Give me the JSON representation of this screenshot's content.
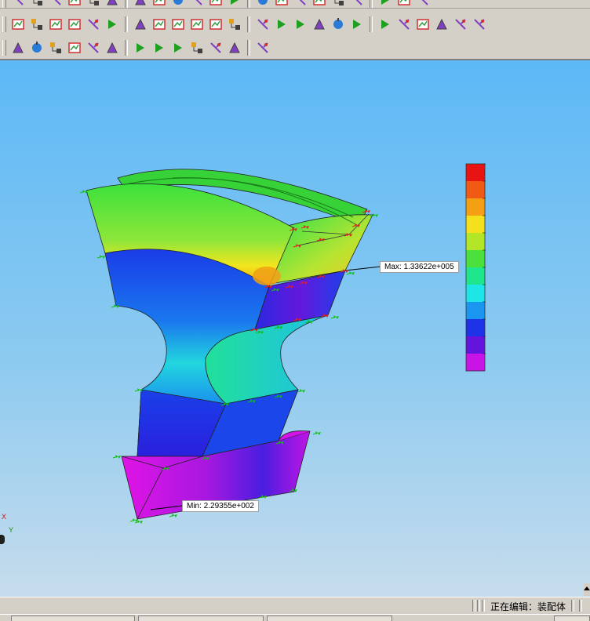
{
  "toolbars": {
    "row1": [
      "hole-wizard-icon",
      "rib-icon",
      "reference-plane-icon",
      "draw-icon",
      "search-icon",
      "properties-icon",
      "smart-dimension-icon",
      "sketch-icon",
      "cosmos-icon",
      "zoom-fit-icon",
      "zoom-area-icon",
      "zoom-in-icon",
      "zoom-out-icon",
      "rotate-icon",
      "pan-icon",
      "view-orientation-icon",
      "section-view-icon",
      "display-mode-icon",
      "shaded-icon",
      "hidden-lines-icon",
      "wireframe-icon"
    ],
    "row2": [
      "fixture-icon",
      "restraint-icon",
      "force-icon",
      "load-icon",
      "gravity-icon",
      "thermal-icon",
      "connector-icon",
      "spring-icon",
      "temperature-icon",
      "mesh-icon",
      "run-icon",
      "plot-stress-icon",
      "plot-displacement-icon",
      "plot-strain-icon",
      "plot-deformation-icon",
      "list-results-icon",
      "play-icon",
      "animate-icon",
      "iso-clipping-icon",
      "section-clipping-icon",
      "probe-icon",
      "report-icon",
      "compare-icon",
      "design-check-icon"
    ],
    "row3": [
      "edit-definition-icon",
      "chart-options-icon",
      "settings-icon",
      "study-properties-icon",
      "display-icon",
      "stop-icon",
      "record-icon",
      "first-frame-icon",
      "next-frame-icon",
      "pointer-icon",
      "refresh-icon",
      "link-icon",
      "apple-icon"
    ]
  },
  "plot": {
    "legend": {
      "colors": [
        "#e81414",
        "#f05a14",
        "#f5a014",
        "#f5e01e",
        "#b4e628",
        "#4ce03c",
        "#1ee68c",
        "#1ee6e6",
        "#1a96f0",
        "#1e32e8",
        "#6414dc",
        "#c814e6"
      ]
    },
    "max_label": "Max: 1.33622e+005",
    "min_label": "Min: 2.29355e+002",
    "triad": {
      "x_label": "X",
      "y_label": "Y"
    }
  },
  "statusbar": {
    "text": "正在编辑：装配体"
  }
}
